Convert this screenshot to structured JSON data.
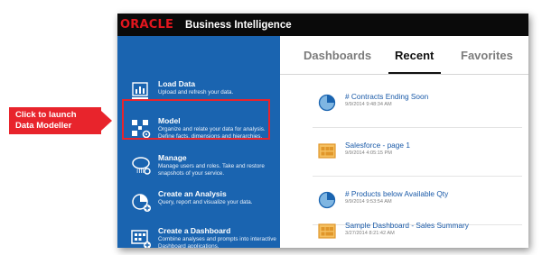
{
  "callout": {
    "text_line1": "Click to launch",
    "text_line2": "Data Modeller"
  },
  "header": {
    "logo_text": "ORACLE",
    "app_title": "Business Intelligence"
  },
  "left_panel": {
    "items": [
      {
        "title": "Load Data",
        "desc": "Upload and refresh your data.",
        "icon": "load-data-icon"
      },
      {
        "title": "Model",
        "desc": "Organize and relate your data for analysis. Define facts, dimensions and hierarchies.",
        "icon": "model-icon"
      },
      {
        "title": "Manage",
        "desc": "Manage users and roles. Take and restore snapshots of your service.",
        "icon": "manage-icon"
      },
      {
        "title": "Create an Analysis",
        "desc": "Query, report and visualize your data.",
        "icon": "create-analysis-icon"
      },
      {
        "title": "Create a Dashboard",
        "desc": "Combine analyses and prompts into interactive Dashboard applications.",
        "icon": "create-dashboard-icon"
      }
    ]
  },
  "tabs": [
    {
      "label": "Dashboards"
    },
    {
      "label": "Recent"
    },
    {
      "label": "Favorites"
    }
  ],
  "recent": [
    {
      "title": "# Contracts Ending Soon",
      "date": "9/9/2014 9:48:34 AM",
      "icon": "analysis-icon"
    },
    {
      "title": "Salesforce - page 1",
      "date": "9/9/2014 4:05:15 PM",
      "icon": "dashboard-icon"
    },
    {
      "title": "# Products below Available Qty",
      "date": "9/9/2014 9:53:54 AM",
      "icon": "analysis-icon"
    },
    {
      "title": "Sample Dashboard - Sales Summary",
      "date": "3/27/2014 8:21:42 AM",
      "icon": "dashboard-icon"
    }
  ],
  "colors": {
    "brand_red": "#e3161e",
    "panel_blue": "#1a64b0",
    "link_blue": "#1a5aa8",
    "callout_red": "#e8242c",
    "dashboard_orange": "#f0a030"
  }
}
